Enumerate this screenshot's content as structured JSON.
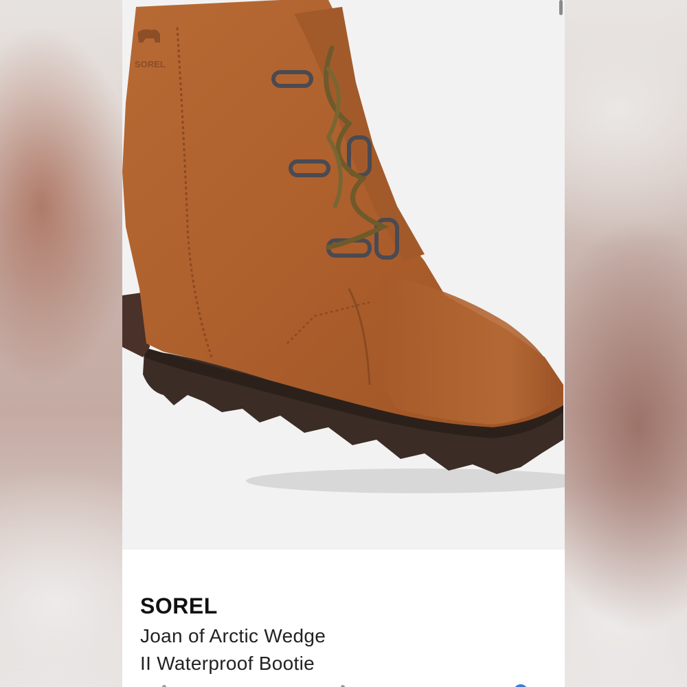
{
  "product": {
    "brand": "SOREL",
    "title_line1": "Joan of Arctic Wedge",
    "title_line2": "II Waterproof Bootie",
    "image_name": "brown suede wedge bootie",
    "logo_text": "SOREL"
  },
  "colors": {
    "suede": "#b0622e",
    "sole": "#3b2c26",
    "laces": "#6e5a2b",
    "background": "#f2f2f2"
  }
}
